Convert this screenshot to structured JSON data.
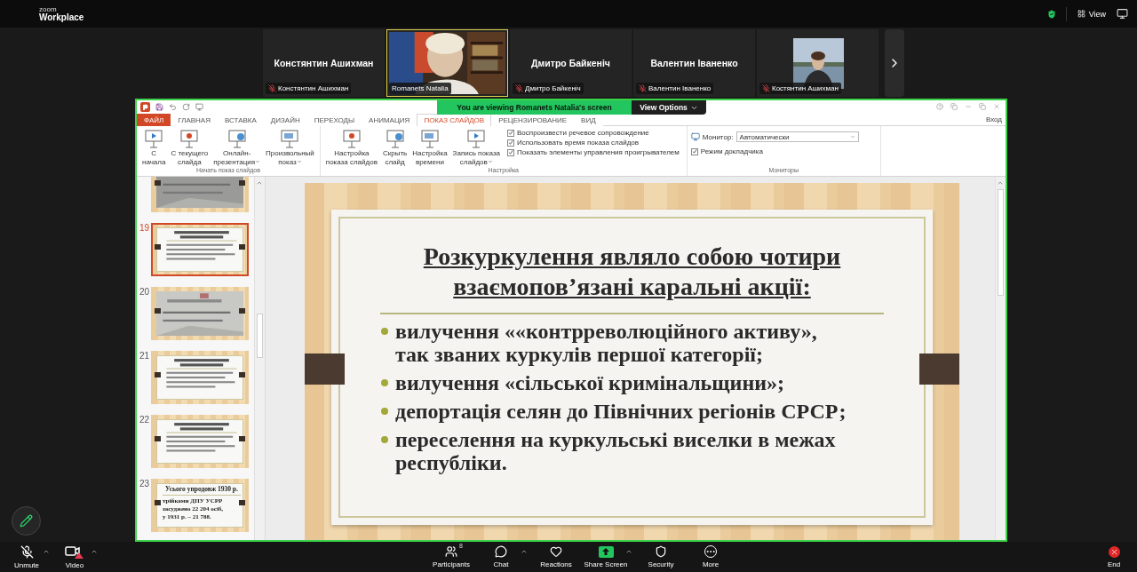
{
  "app": {
    "logo_small": "zoom",
    "logo_big": "Workplace",
    "view_button": "View"
  },
  "gallery": {
    "tiles": [
      {
        "kind": "name",
        "name": "Констянтин Ашихман",
        "label": "Констянтин Ашихман",
        "muted": true,
        "speaking": false
      },
      {
        "kind": "video",
        "label": "Romanets Natalia",
        "muted": false,
        "speaking": true
      },
      {
        "kind": "name",
        "name": "Дмитро Байкеніч",
        "label": "Дмитро Байкеніч",
        "muted": true,
        "speaking": false
      },
      {
        "kind": "name",
        "name": "Валентин Іваненко",
        "label": "Валентин Іваненко",
        "muted": true,
        "speaking": false
      },
      {
        "kind": "avatar",
        "label": "Костянтин Ашихман",
        "muted": true,
        "speaking": false
      }
    ]
  },
  "share": {
    "banner": "You are viewing Romanets Natalia's screen",
    "view_options": "View Options"
  },
  "powerpoint": {
    "tabs": [
      {
        "label": "ФАЙЛ",
        "kind": "file",
        "selected": false
      },
      {
        "label": "ГЛАВНАЯ",
        "kind": "tab",
        "selected": false
      },
      {
        "label": "ВСТАВКА",
        "kind": "tab",
        "selected": false
      },
      {
        "label": "ДИЗАЙН",
        "kind": "tab",
        "selected": false
      },
      {
        "label": "ПЕРЕХОДЫ",
        "kind": "tab",
        "selected": false
      },
      {
        "label": "АНИМАЦИЯ",
        "kind": "tab",
        "selected": false
      },
      {
        "label": "ПОКАЗ СЛАЙДОВ",
        "kind": "tab",
        "selected": true
      },
      {
        "label": "РЕЦЕНЗИРОВАНИЕ",
        "kind": "tab",
        "selected": false
      },
      {
        "label": "ВИД",
        "kind": "tab",
        "selected": false
      }
    ],
    "sign_in": "Вход",
    "ribbon": {
      "start_group": {
        "title": "Начать показ слайдов",
        "buttons": [
          {
            "lines": [
              "С",
              "начала"
            ],
            "dropdown": false
          },
          {
            "lines": [
              "С текущего",
              "слайда"
            ],
            "dropdown": false
          },
          {
            "lines": [
              "Онлайн-",
              "презентация"
            ],
            "dropdown": true
          },
          {
            "lines": [
              "Произвольный",
              "показ"
            ],
            "dropdown": true
          }
        ]
      },
      "setup_group": {
        "title": "Настройка",
        "buttons": [
          {
            "lines": [
              "Настройка",
              "показа слайдов"
            ],
            "dropdown": false
          },
          {
            "lines": [
              "Скрыть",
              "слайд"
            ],
            "dropdown": false
          },
          {
            "lines": [
              "Настройка",
              "времени"
            ],
            "dropdown": false
          },
          {
            "lines": [
              "Запись показа",
              "слайдов"
            ],
            "dropdown": true
          }
        ],
        "checkboxes": [
          {
            "label": "Воспроизвести речевое сопровождение",
            "checked": true
          },
          {
            "label": "Использовать время показа слайдов",
            "checked": true
          },
          {
            "label": "Показать элементы управления проигрывателем",
            "checked": true
          }
        ]
      },
      "monitors_group": {
        "title": "Мониторы",
        "monitor_label": "Монитор:",
        "monitor_value": "Автоматически",
        "presenter": {
          "label": "Режим докладчика",
          "checked": true
        }
      }
    },
    "thumbnails": [
      {
        "kind": "picture",
        "selected": false
      },
      {
        "number": "19",
        "kind": "text",
        "selected": true
      },
      {
        "number": "20",
        "kind": "picture",
        "selected": false
      },
      {
        "number": "21",
        "kind": "text",
        "selected": false
      },
      {
        "number": "22",
        "kind": "text",
        "selected": false
      },
      {
        "number": "23",
        "kind": "text",
        "selected": false,
        "lines": [
          "Усього упродовж 1930 р.",
          "трійками ДПУ УСРР",
          "засуджено 22 204 осіб,",
          "у 1931 р. – 21 788."
        ]
      }
    ],
    "slide": {
      "title_lines": [
        "Розкуркулення являло собою чотири",
        "взаємопов’язані каральні акції:"
      ],
      "bullets": [
        {
          "lines": [
            "вилучення ««контрреволюційного активу»,",
            "так званих куркулів першої категорії;"
          ]
        },
        {
          "lines": [
            "вилучення «сільської кримінальщини»;"
          ]
        },
        {
          "lines": [
            "депортація селян до Північних регіонів СРСР;"
          ]
        },
        {
          "lines": [
            "переселення на куркульські виселки в межах",
            "республіки."
          ]
        }
      ]
    }
  },
  "toolbar": {
    "left": [
      {
        "kind": "audio",
        "label": "Unmute"
      },
      {
        "kind": "video",
        "label": "Video"
      }
    ],
    "center": [
      {
        "kind": "participants",
        "label": "Participants",
        "count": "8"
      },
      {
        "kind": "chat",
        "label": "Chat"
      },
      {
        "kind": "reactions",
        "label": "Reactions"
      },
      {
        "kind": "share",
        "label": "Share Screen"
      },
      {
        "kind": "security",
        "label": "Security"
      },
      {
        "kind": "more",
        "label": "More"
      }
    ],
    "end": "End"
  }
}
